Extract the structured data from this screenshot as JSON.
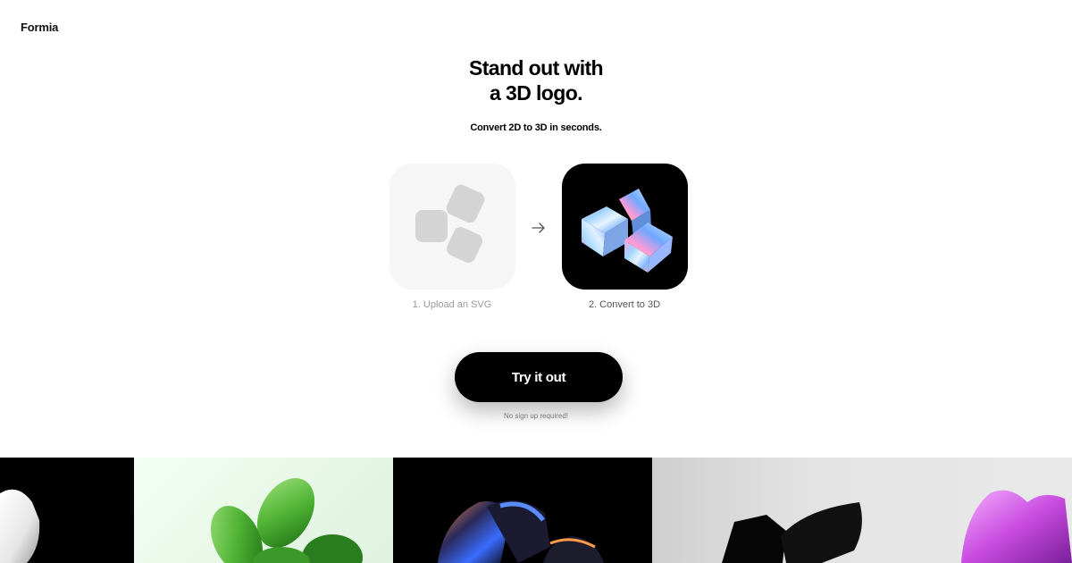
{
  "brand": {
    "name": "Formia"
  },
  "hero": {
    "title_line1": "Stand out with",
    "title_line2": "a 3D logo.",
    "subtitle": "Convert 2D to 3D in seconds."
  },
  "steps": [
    {
      "label": "1. Upload an SVG"
    },
    {
      "label": "2. Convert to 3D"
    }
  ],
  "cta": {
    "label": "Try it out",
    "note": "No sign up required!"
  },
  "gallery": {
    "tiles": [
      {
        "description": "white 3d logo on black"
      },
      {
        "description": "green glossy clover on mint"
      },
      {
        "description": "dark iridescent shapes on black"
      },
      {
        "description": "black 3d shapes on light grey"
      },
      {
        "description": "pink glossy flower on light grey"
      }
    ]
  },
  "colors": {
    "background": "#ffffff",
    "cta_bg": "#000000",
    "cta_text": "#ffffff"
  }
}
